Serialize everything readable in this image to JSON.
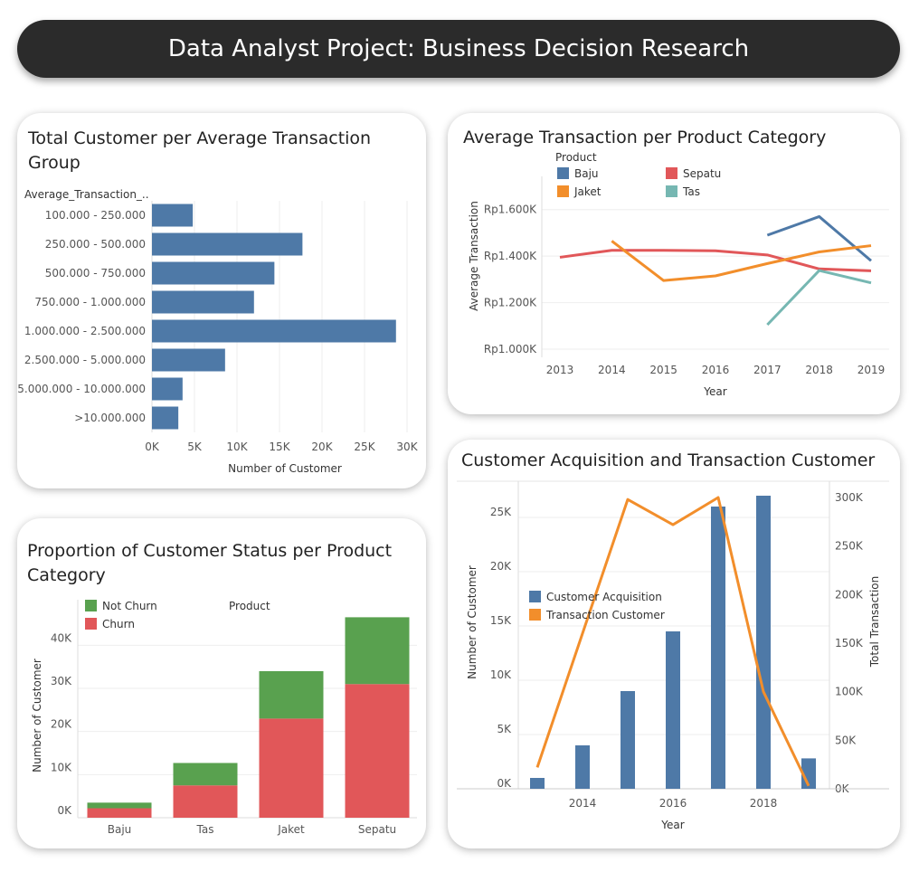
{
  "header": {
    "title": "Data Analyst Project: Business Decision Research"
  },
  "colors": {
    "blue": "#4e79a7",
    "red": "#e15759",
    "orange": "#f28e2b",
    "teal": "#76b7b2",
    "green": "#59a14f",
    "grid": "#eeeeee"
  },
  "chart_data": [
    {
      "id": "chart1",
      "type": "bar",
      "orientation": "horizontal",
      "title": "Total Customer per Average Transaction Group",
      "row_header": "Average_Transaction_..",
      "xlabel": "Number of Customer",
      "categories": [
        "100.000 - 250.000",
        "250.000 - 500.000",
        "500.000 - 750.000",
        "750.000 - 1.000.000",
        "1.000.000 - 2.500.000",
        "2.500.000 - 5.000.000",
        "5.000.000 - 10.000.000",
        ">10.000.000"
      ],
      "values": [
        4800,
        17700,
        14400,
        12000,
        28700,
        8600,
        3600,
        3100
      ],
      "xlim": [
        0,
        30000
      ],
      "xticks": [
        0,
        5000,
        10000,
        15000,
        20000,
        25000,
        30000
      ],
      "xtick_labels": [
        "0K",
        "5K",
        "10K",
        "15K",
        "20K",
        "25K",
        "30K"
      ]
    },
    {
      "id": "chart2",
      "type": "line",
      "title": "Average Transaction per Product Category",
      "xlabel": "Year",
      "ylabel": "Average Transaction",
      "legend_title": "Product",
      "x": [
        2013,
        2014,
        2015,
        2016,
        2017,
        2018,
        2019
      ],
      "ylim": [
        1000000,
        1700000
      ],
      "yticks": [
        1000000,
        1200000,
        1400000,
        1600000
      ],
      "ytick_labels": [
        "Rp1.000K",
        "Rp1.200K",
        "Rp1.400K",
        "Rp1.600K"
      ],
      "series": [
        {
          "name": "Baju",
          "color": "#4e79a7",
          "values": [
            null,
            null,
            null,
            null,
            1490000,
            1570000,
            1380000
          ]
        },
        {
          "name": "Sepatu",
          "color": "#e15759",
          "values": [
            1395000,
            1425000,
            1425000,
            1423000,
            1405000,
            1345000,
            1337000
          ]
        },
        {
          "name": "Jaket",
          "color": "#f28e2b",
          "values": [
            null,
            1465000,
            1295000,
            1315000,
            1368000,
            1418000,
            1445000
          ]
        },
        {
          "name": "Tas",
          "color": "#76b7b2",
          "values": [
            null,
            null,
            null,
            null,
            1105000,
            1338000,
            1285000
          ]
        }
      ]
    },
    {
      "id": "chart3",
      "type": "bar",
      "stacked": true,
      "title": "Proportion of Customer Status per Product Category",
      "ylabel": "Number of Customer",
      "legend_title": "Product",
      "categories": [
        "Baju",
        "Tas",
        "Jaket",
        "Sepatu"
      ],
      "ylim": [
        0,
        47000
      ],
      "yticks": [
        0,
        10000,
        20000,
        30000,
        40000
      ],
      "ytick_labels": [
        "0K",
        "10K",
        "20K",
        "30K",
        "40K"
      ],
      "series": [
        {
          "name": "Churn",
          "color": "#e15759",
          "values": [
            2200,
            7500,
            23000,
            31000
          ]
        },
        {
          "name": "Not Churn",
          "color": "#59a14f",
          "values": [
            1300,
            5200,
            11000,
            15500
          ]
        }
      ]
    },
    {
      "id": "chart4",
      "type": "bar",
      "title": "Customer Acquisition and Transaction Customer",
      "xlabel": "Year",
      "ylabel": "Number of Customer",
      "y2label": "Total Transaction",
      "x": [
        2013,
        2014,
        2015,
        2016,
        2017,
        2018,
        2019
      ],
      "xtick_labels": [
        "2014",
        "2016",
        "2018"
      ],
      "xtick_values": [
        2014,
        2016,
        2018
      ],
      "ylim": [
        0,
        27000
      ],
      "yticks": [
        0,
        5000,
        10000,
        15000,
        20000,
        25000
      ],
      "ytick_labels": [
        "0K",
        "5K",
        "10K",
        "15K",
        "20K",
        "25K"
      ],
      "y2lim": [
        0,
        300000
      ],
      "y2ticks": [
        0,
        50000,
        100000,
        150000,
        200000,
        250000,
        300000
      ],
      "y2tick_labels": [
        "0K",
        "50K",
        "100K",
        "150K",
        "200K",
        "250K",
        "300K"
      ],
      "series": [
        {
          "name": "Customer Acquisition",
          "type": "bar",
          "axis": "left",
          "color": "#4e79a7",
          "values": [
            1000,
            4000,
            9000,
            14500,
            26000,
            27000,
            2800
          ]
        },
        {
          "name": "Transaction Customer",
          "type": "line",
          "axis": "right",
          "color": "#f28e2b",
          "values": [
            22000,
            160000,
            298000,
            272000,
            300000,
            100000,
            3000
          ]
        }
      ]
    }
  ]
}
